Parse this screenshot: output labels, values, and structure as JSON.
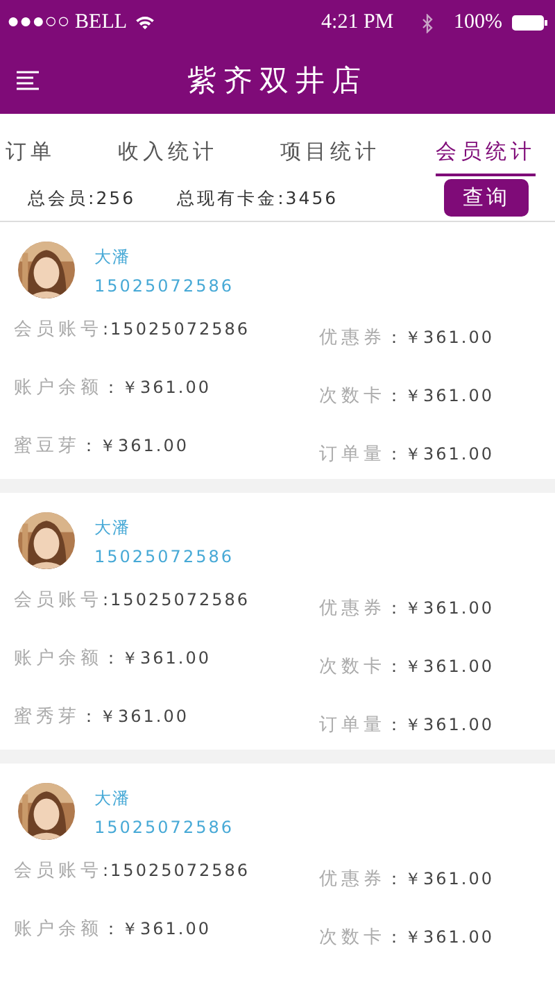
{
  "status_bar": {
    "carrier": "●●●○○ BELL",
    "time": "4:21 PM",
    "battery": "100%"
  },
  "header": {
    "title": "紫齐双井店"
  },
  "tabs": [
    {
      "label": "订单",
      "selected": false
    },
    {
      "label": "收入统计",
      "selected": false
    },
    {
      "label": "项目统计",
      "selected": false
    },
    {
      "label": "会员统计",
      "selected": true
    }
  ],
  "summary": {
    "members": "总会员:256",
    "card_balance": "总现有卡金:3456",
    "query_button": "查询"
  },
  "members": [
    {
      "name": "大潘",
      "phone": "15025072586",
      "fields": [
        {
          "label": "会员账号",
          "value": ":15025072586"
        },
        {
          "label": "优惠券",
          "value": "：￥361.00"
        },
        {
          "label": "账户余额",
          "value": "：￥361.00"
        },
        {
          "label": "次数卡",
          "value": "：￥361.00"
        },
        {
          "label": "蜜豆芽",
          "value": "：￥361.00"
        },
        {
          "label": "订单量",
          "value": "：￥361.00"
        }
      ]
    },
    {
      "name": "大潘",
      "phone": "15025072586",
      "fields": [
        {
          "label": "会员账号",
          "value": ":15025072586"
        },
        {
          "label": "优惠券",
          "value": "：￥361.00"
        },
        {
          "label": "账户余额",
          "value": "：￥361.00"
        },
        {
          "label": "次数卡",
          "value": "：￥361.00"
        },
        {
          "label": "蜜秀芽",
          "value": "：￥361.00"
        },
        {
          "label": "订单量",
          "value": "：￥361.00"
        }
      ]
    },
    {
      "name": "大潘",
      "phone": "15025072586",
      "fields": [
        {
          "label": "会员账号",
          "value": ":15025072586"
        },
        {
          "label": "优惠券",
          "value": "：￥361.00"
        },
        {
          "label": "账户余额",
          "value": "：￥361.00"
        },
        {
          "label": "次数卡",
          "value": "：￥361.00"
        }
      ]
    }
  ]
}
